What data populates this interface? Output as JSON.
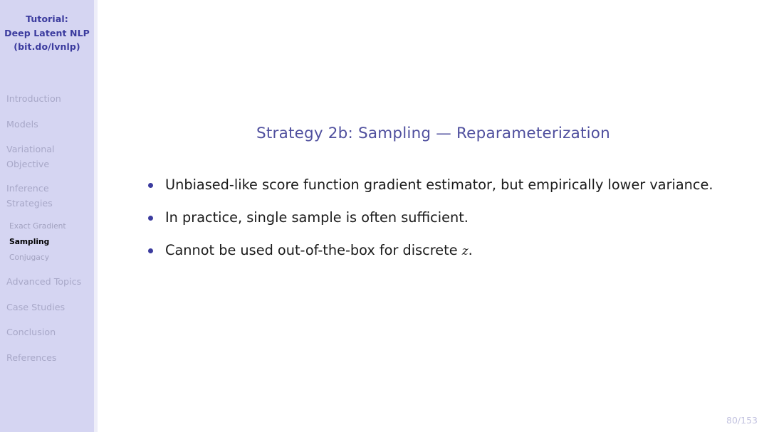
{
  "sidebar": {
    "deck_title_lines": [
      "Tutorial:",
      "Deep Latent NLP",
      "(bit.do/lvnlp)"
    ],
    "nav_items": [
      {
        "label": "Introduction",
        "line2": ""
      },
      {
        "label": "Models",
        "line2": ""
      },
      {
        "label": "Variational",
        "line2": "Objective"
      },
      {
        "label": "Inference",
        "line2": "Strategies"
      }
    ],
    "sub_items": [
      {
        "label": "Exact Gradient",
        "active": false
      },
      {
        "label": "Sampling",
        "active": true
      },
      {
        "label": "Conjugacy",
        "active": false
      }
    ],
    "nav_items_after": [
      {
        "label": "Advanced Topics",
        "line2": ""
      },
      {
        "label": "Case Studies",
        "line2": ""
      },
      {
        "label": "Conclusion",
        "line2": ""
      },
      {
        "label": "References",
        "line2": ""
      }
    ]
  },
  "main": {
    "title": "Strategy 2b: Sampling — Reparameterization",
    "bullets": [
      {
        "text": "Unbiased-like score function gradient estimator, but empirically lower variance.",
        "math_tail": "",
        "tail_text": ""
      },
      {
        "text": "In practice, single sample is often sufficient.",
        "math_tail": "",
        "tail_text": ""
      },
      {
        "text": "Cannot be used out-of-the-box for discrete ",
        "math_tail": "z",
        "tail_text": "."
      }
    ]
  },
  "footer": {
    "page_number": "80/153"
  },
  "colors": {
    "sidebar_bg": "#d5d5f2",
    "deck_title": "#3b3b9e",
    "nav_text": "#a8a8c8",
    "nav_sub_text": "#a2a2c0",
    "nav_active": "#000000",
    "slide_title": "#4f4f9e",
    "body_text": "#1a1a1a",
    "bullet_dot": "#3b3b9e",
    "page_number": "#c3c3e0"
  }
}
